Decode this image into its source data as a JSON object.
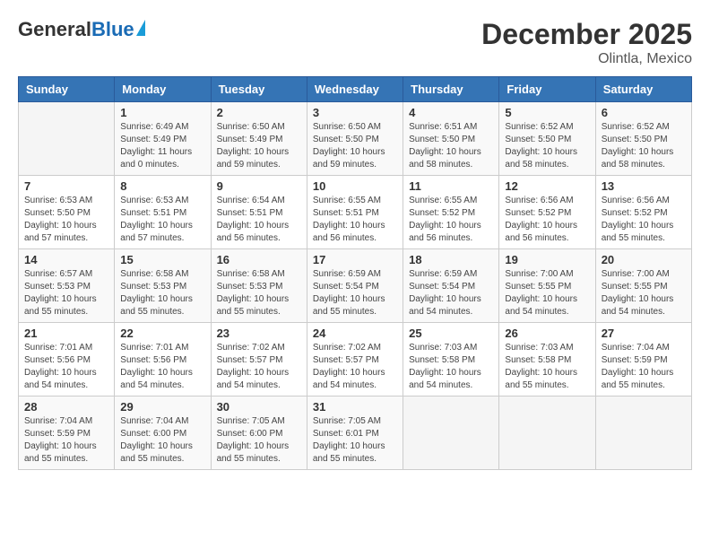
{
  "header": {
    "logo": {
      "general": "General",
      "blue": "Blue"
    },
    "title": "December 2025",
    "location": "Olintla, Mexico"
  },
  "calendar": {
    "weekdays": [
      "Sunday",
      "Monday",
      "Tuesday",
      "Wednesday",
      "Thursday",
      "Friday",
      "Saturday"
    ],
    "weeks": [
      [
        {
          "day": "",
          "info": ""
        },
        {
          "day": "1",
          "info": "Sunrise: 6:49 AM\nSunset: 5:49 PM\nDaylight: 11 hours\nand 0 minutes."
        },
        {
          "day": "2",
          "info": "Sunrise: 6:50 AM\nSunset: 5:49 PM\nDaylight: 10 hours\nand 59 minutes."
        },
        {
          "day": "3",
          "info": "Sunrise: 6:50 AM\nSunset: 5:50 PM\nDaylight: 10 hours\nand 59 minutes."
        },
        {
          "day": "4",
          "info": "Sunrise: 6:51 AM\nSunset: 5:50 PM\nDaylight: 10 hours\nand 58 minutes."
        },
        {
          "day": "5",
          "info": "Sunrise: 6:52 AM\nSunset: 5:50 PM\nDaylight: 10 hours\nand 58 minutes."
        },
        {
          "day": "6",
          "info": "Sunrise: 6:52 AM\nSunset: 5:50 PM\nDaylight: 10 hours\nand 58 minutes."
        }
      ],
      [
        {
          "day": "7",
          "info": "Sunrise: 6:53 AM\nSunset: 5:50 PM\nDaylight: 10 hours\nand 57 minutes."
        },
        {
          "day": "8",
          "info": "Sunrise: 6:53 AM\nSunset: 5:51 PM\nDaylight: 10 hours\nand 57 minutes."
        },
        {
          "day": "9",
          "info": "Sunrise: 6:54 AM\nSunset: 5:51 PM\nDaylight: 10 hours\nand 56 minutes."
        },
        {
          "day": "10",
          "info": "Sunrise: 6:55 AM\nSunset: 5:51 PM\nDaylight: 10 hours\nand 56 minutes."
        },
        {
          "day": "11",
          "info": "Sunrise: 6:55 AM\nSunset: 5:52 PM\nDaylight: 10 hours\nand 56 minutes."
        },
        {
          "day": "12",
          "info": "Sunrise: 6:56 AM\nSunset: 5:52 PM\nDaylight: 10 hours\nand 56 minutes."
        },
        {
          "day": "13",
          "info": "Sunrise: 6:56 AM\nSunset: 5:52 PM\nDaylight: 10 hours\nand 55 minutes."
        }
      ],
      [
        {
          "day": "14",
          "info": "Sunrise: 6:57 AM\nSunset: 5:53 PM\nDaylight: 10 hours\nand 55 minutes."
        },
        {
          "day": "15",
          "info": "Sunrise: 6:58 AM\nSunset: 5:53 PM\nDaylight: 10 hours\nand 55 minutes."
        },
        {
          "day": "16",
          "info": "Sunrise: 6:58 AM\nSunset: 5:53 PM\nDaylight: 10 hours\nand 55 minutes."
        },
        {
          "day": "17",
          "info": "Sunrise: 6:59 AM\nSunset: 5:54 PM\nDaylight: 10 hours\nand 55 minutes."
        },
        {
          "day": "18",
          "info": "Sunrise: 6:59 AM\nSunset: 5:54 PM\nDaylight: 10 hours\nand 54 minutes."
        },
        {
          "day": "19",
          "info": "Sunrise: 7:00 AM\nSunset: 5:55 PM\nDaylight: 10 hours\nand 54 minutes."
        },
        {
          "day": "20",
          "info": "Sunrise: 7:00 AM\nSunset: 5:55 PM\nDaylight: 10 hours\nand 54 minutes."
        }
      ],
      [
        {
          "day": "21",
          "info": "Sunrise: 7:01 AM\nSunset: 5:56 PM\nDaylight: 10 hours\nand 54 minutes."
        },
        {
          "day": "22",
          "info": "Sunrise: 7:01 AM\nSunset: 5:56 PM\nDaylight: 10 hours\nand 54 minutes."
        },
        {
          "day": "23",
          "info": "Sunrise: 7:02 AM\nSunset: 5:57 PM\nDaylight: 10 hours\nand 54 minutes."
        },
        {
          "day": "24",
          "info": "Sunrise: 7:02 AM\nSunset: 5:57 PM\nDaylight: 10 hours\nand 54 minutes."
        },
        {
          "day": "25",
          "info": "Sunrise: 7:03 AM\nSunset: 5:58 PM\nDaylight: 10 hours\nand 54 minutes."
        },
        {
          "day": "26",
          "info": "Sunrise: 7:03 AM\nSunset: 5:58 PM\nDaylight: 10 hours\nand 55 minutes."
        },
        {
          "day": "27",
          "info": "Sunrise: 7:04 AM\nSunset: 5:59 PM\nDaylight: 10 hours\nand 55 minutes."
        }
      ],
      [
        {
          "day": "28",
          "info": "Sunrise: 7:04 AM\nSunset: 5:59 PM\nDaylight: 10 hours\nand 55 minutes."
        },
        {
          "day": "29",
          "info": "Sunrise: 7:04 AM\nSunset: 6:00 PM\nDaylight: 10 hours\nand 55 minutes."
        },
        {
          "day": "30",
          "info": "Sunrise: 7:05 AM\nSunset: 6:00 PM\nDaylight: 10 hours\nand 55 minutes."
        },
        {
          "day": "31",
          "info": "Sunrise: 7:05 AM\nSunset: 6:01 PM\nDaylight: 10 hours\nand 55 minutes."
        },
        {
          "day": "",
          "info": ""
        },
        {
          "day": "",
          "info": ""
        },
        {
          "day": "",
          "info": ""
        }
      ]
    ]
  }
}
